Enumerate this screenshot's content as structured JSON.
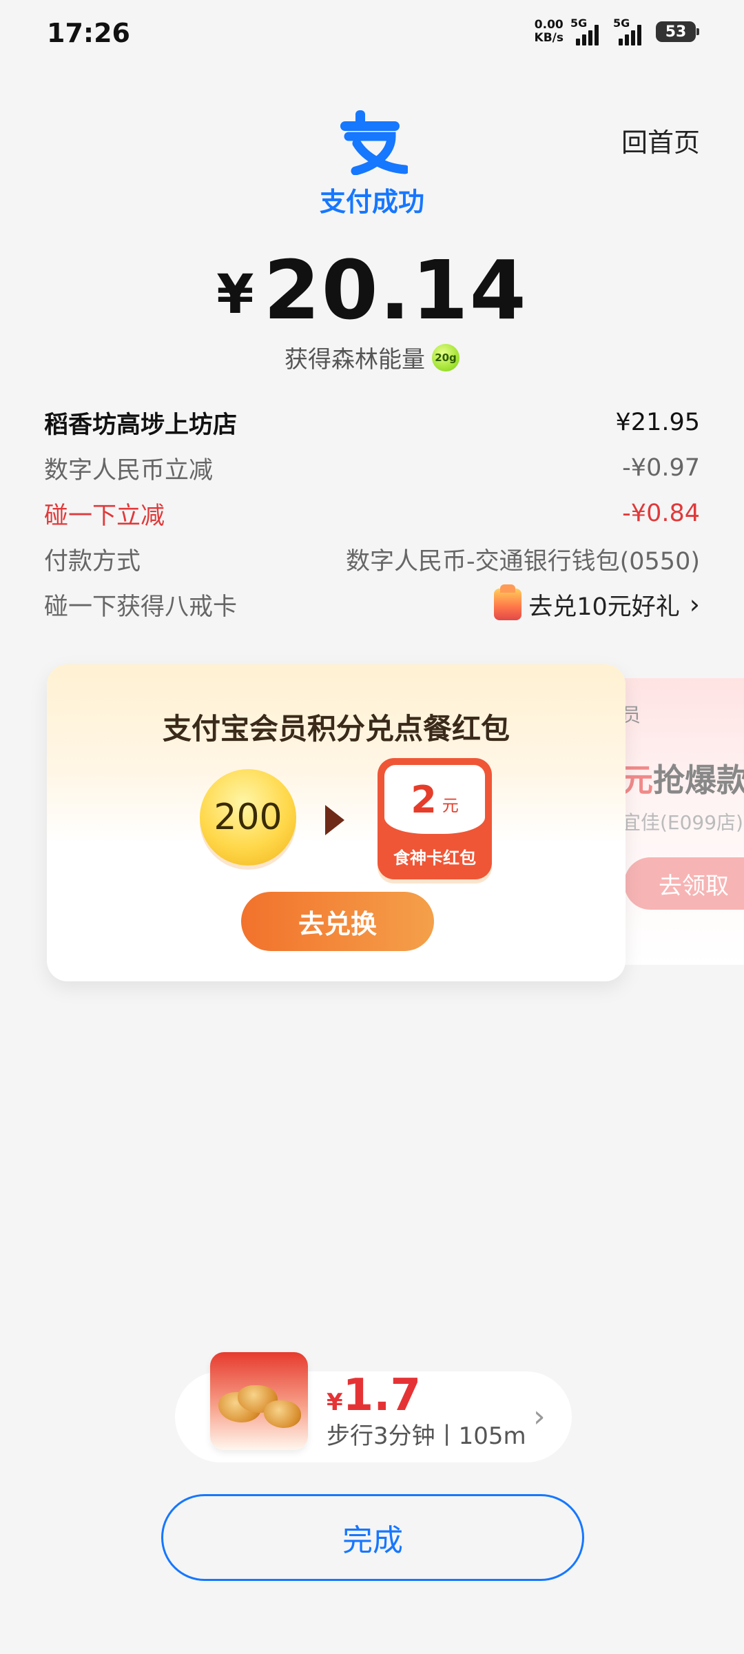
{
  "status_bar": {
    "time": "17:26",
    "net_speed_value": "0.00",
    "net_speed_unit": "KB/s",
    "network1": "5G",
    "network2": "5G",
    "battery": "53"
  },
  "header": {
    "home_link": "回首页",
    "logo_icon": "alipay-logo-icon",
    "status": "支付成功",
    "brand_color": "#1677ff"
  },
  "amount": {
    "currency": "¥",
    "value": "20.14",
    "energy_text": "获得森林能量",
    "energy_badge": "20g"
  },
  "details": {
    "merchant": {
      "label": "稻香坊高埗上坊店",
      "value": "¥21.95"
    },
    "discount1": {
      "label": "数字人民币立减",
      "value": "-¥0.97"
    },
    "discount2": {
      "label": "碰一下立减",
      "value": "-¥0.84"
    },
    "payment": {
      "label": "付款方式",
      "value": "数字人民币-交通银行钱包(0550)"
    },
    "card": {
      "label": "碰一下获得八戒卡",
      "value": "去兑10元好礼",
      "chevron": "›"
    }
  },
  "card_main": {
    "title": "支付宝会员积分兑点餐红包",
    "points": "200",
    "redpack_amount": "2",
    "redpack_unit": "元",
    "redpack_label": "食神卡红包",
    "button": "去兑换"
  },
  "card_side": {
    "line1": "员",
    "line2_highlight": "元",
    "line2": "抢爆款",
    "line3": "宜佳(E099店)",
    "button": "去领取"
  },
  "promo": {
    "currency": "¥",
    "price": "1.7",
    "subtitle": "步行3分钟丨105m",
    "chevron": "›"
  },
  "done_button": "完成"
}
